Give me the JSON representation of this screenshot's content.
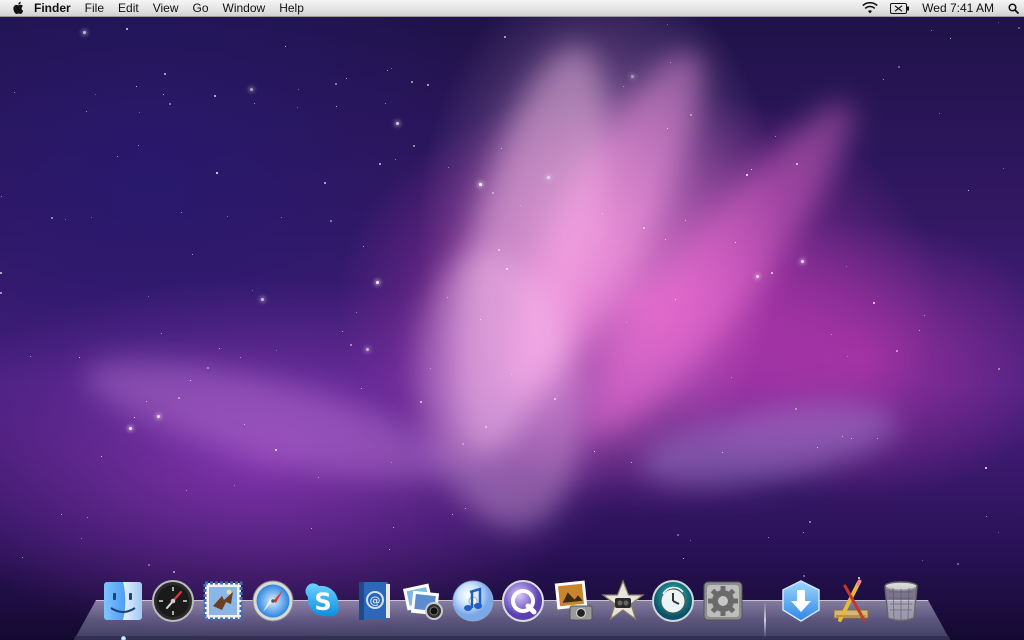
{
  "menubar": {
    "app_name": "Finder",
    "menus": [
      "File",
      "Edit",
      "View",
      "Go",
      "Window",
      "Help"
    ],
    "clock": "Wed 7:41 AM",
    "status_icons": [
      "wifi-icon",
      "battery-icon",
      "spotlight-icon"
    ]
  },
  "dock": {
    "items": [
      {
        "icon": "finder-icon",
        "running": true
      },
      {
        "icon": "dashboard-icon",
        "running": false
      },
      {
        "icon": "mail-icon",
        "running": false
      },
      {
        "icon": "safari-icon",
        "running": false
      },
      {
        "icon": "skype-icon",
        "running": false
      },
      {
        "icon": "address-book-icon",
        "running": false
      },
      {
        "icon": "iphoto-icon",
        "running": false
      },
      {
        "icon": "itunes-icon",
        "running": false
      },
      {
        "icon": "quicktime-icon",
        "running": false
      },
      {
        "icon": "image-capture-icon",
        "running": false
      },
      {
        "icon": "imovie-icon",
        "running": false
      },
      {
        "icon": "time-machine-icon",
        "running": false
      },
      {
        "icon": "system-preferences-icon",
        "running": false
      }
    ],
    "stacks": [
      {
        "icon": "downloads-stack-icon"
      },
      {
        "icon": "applications-stack-icon"
      },
      {
        "icon": "trash-icon"
      }
    ]
  },
  "colors": {
    "menubar_bg": "#e3e3e3",
    "wallpaper_primary": "#d64fc7",
    "wallpaper_deep": "#241252"
  }
}
